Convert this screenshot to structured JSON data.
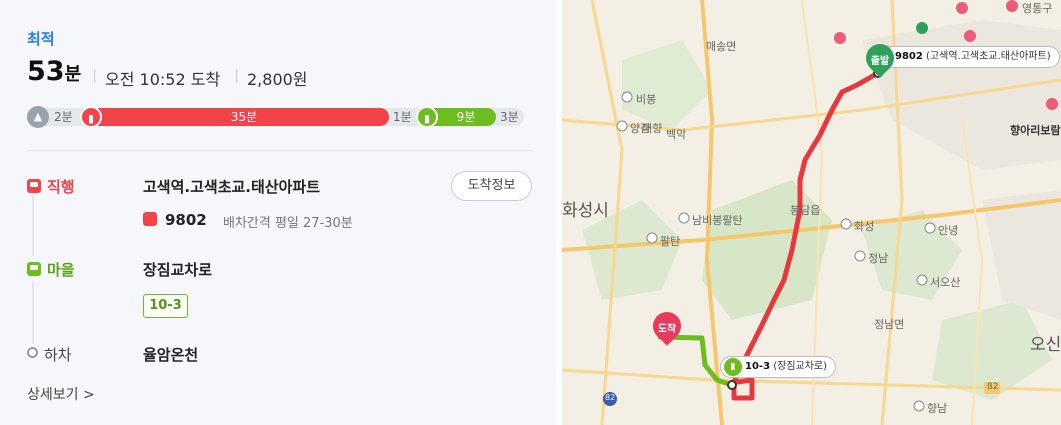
{
  "summary": {
    "badge": "최적",
    "total_minutes": "53",
    "minutes_unit": "분",
    "arrival": "오전 10:52 도착",
    "fare": "2,800원"
  },
  "timeline": {
    "walk1": "2분",
    "bus_red": "35분",
    "walk2": "1분",
    "bus_green": "9분",
    "walk3": "3분"
  },
  "legs": [
    {
      "mode_label": "직행",
      "stop": "고색역.고색초교.태산아파트",
      "arrival_button": "도착정보",
      "bus_number": "9802",
      "interval": "배차간격 평일 27-30분"
    },
    {
      "mode_label": "마을",
      "stop": "장짐교차로",
      "route": "10-3"
    }
  ],
  "alight": {
    "label": "하차",
    "stop": "율암온천"
  },
  "details_link": "상세보기 >",
  "map": {
    "start_pin": "출발",
    "end_pin": "도착",
    "start_callout_bus": "9802",
    "start_callout_stop": "(고색역.고색초교.태산아파트)",
    "transfer_callout_bus": "10-3",
    "transfer_callout_stop": "(장짐교차로)",
    "places": {
      "hwaseong": "화성시",
      "osan": "오신",
      "maesong": "매송면",
      "bongdam": "봉담읍",
      "jeongnam": "정남면",
      "hanghari": "향아리보람",
      "bibong": "비봉",
      "maehyang": "매향",
      "yanggam": "양감",
      "baegyak": "백악",
      "nambibong": "남비봉팔탄",
      "paltan": "팔탄",
      "hwaseong_ic": "화성",
      "annyeong": "안녕",
      "jeongnam_ic": "정남",
      "seoosan": "서오산",
      "hyangnam": "향남",
      "r82a": "82",
      "r82b": "82",
      "yeongtong": "영통구"
    }
  },
  "colors": {
    "accent_blue": "#2a7de1",
    "express_red": "#f2434a",
    "village_green": "#6cbd1d",
    "walk_gray": "#9aa3ad"
  }
}
